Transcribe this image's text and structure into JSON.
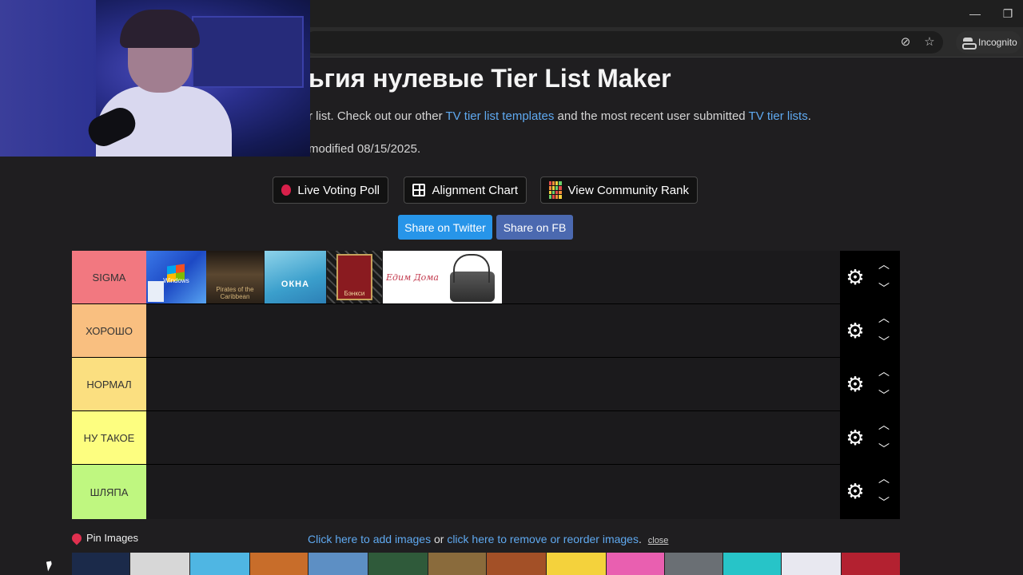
{
  "browser": {
    "incognito_label": "Incognito",
    "minimize_glyph": "—",
    "restore_glyph": "❐",
    "eye_off_glyph": "⊘",
    "star_glyph": "☆"
  },
  "page": {
    "title": "ьгия нулевые Tier List Maker",
    "desc_prefix": "r list. Check out our other ",
    "desc_link1": "TV tier list templates",
    "desc_mid": " and the most recent user submitted ",
    "desc_link2": "TV tier lists",
    "desc_suffix": ".",
    "modified": "modified 08/15/2025."
  },
  "buttons": {
    "live_poll": "Live Voting Poll",
    "alignment": "Alignment Chart",
    "community": "View Community Rank",
    "twitter": "Share on Twitter",
    "fb": "Share on FB"
  },
  "colors": {
    "twitter": "#2795e9",
    "fb": "#4b69b0",
    "tier_sigma": "#f27880",
    "tier_good": "#f9bf80",
    "tier_normal": "#fbdf80",
    "tier_meh": "#fdfe80",
    "tier_hat": "#bff780"
  },
  "tiers": [
    {
      "label": "SIGMA"
    },
    {
      "label": "ХОРОШО"
    },
    {
      "label": "НОРМАЛ"
    },
    {
      "label": "НУ ТАКОЕ"
    },
    {
      "label": "ШЛЯПА"
    }
  ],
  "tier_icons": {
    "settings": "⚙",
    "up": "︿",
    "down": "﹀"
  },
  "tier_images": [
    {
      "name": "windows-xp-image",
      "caption": "Windows"
    },
    {
      "name": "pirates-caribbean-image",
      "caption": "Pirates of the Caribbean"
    },
    {
      "name": "okna-image",
      "caption": "ОКНА"
    },
    {
      "name": "book-cover-image",
      "caption": "Бэнкси"
    },
    {
      "name": "edim-doma-image",
      "caption": "Едим Дома"
    },
    {
      "name": "bag-image",
      "caption": ""
    }
  ],
  "footer": {
    "pin_label": "Pin Images",
    "add_link": "Click here to add images",
    "or_text": " or ",
    "remove_link": "click here to remove or reorder images",
    "period": ". ",
    "close": "close"
  }
}
